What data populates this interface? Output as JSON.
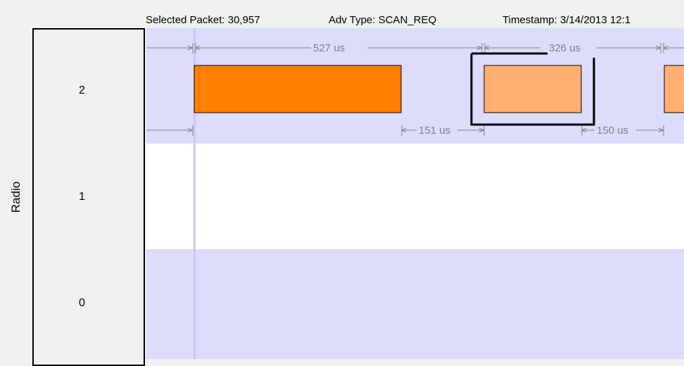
{
  "header": {
    "selected_packet": "Selected Packet: 30,957",
    "adv_type": "Adv Type: SCAN_REQ",
    "timestamp": "Timestamp: 3/14/2013 12:1"
  },
  "axis": {
    "title": "Radio",
    "lanes": [
      "2",
      "1",
      "0"
    ]
  },
  "timeline": {
    "measurements": {
      "first_packet_duration": "527 us",
      "selected_packet_duration": "326 us",
      "gap_after_first": "151 us",
      "gap_after_selected": "150 us"
    },
    "colors": {
      "lane_shaded": "#dcdcfc",
      "lane_plain": "#ffffff",
      "packet_primary": "#ff8000",
      "packet_secondary": "#ffb070",
      "dimension_line": "#808080",
      "selection_frame": "#000000"
    }
  }
}
